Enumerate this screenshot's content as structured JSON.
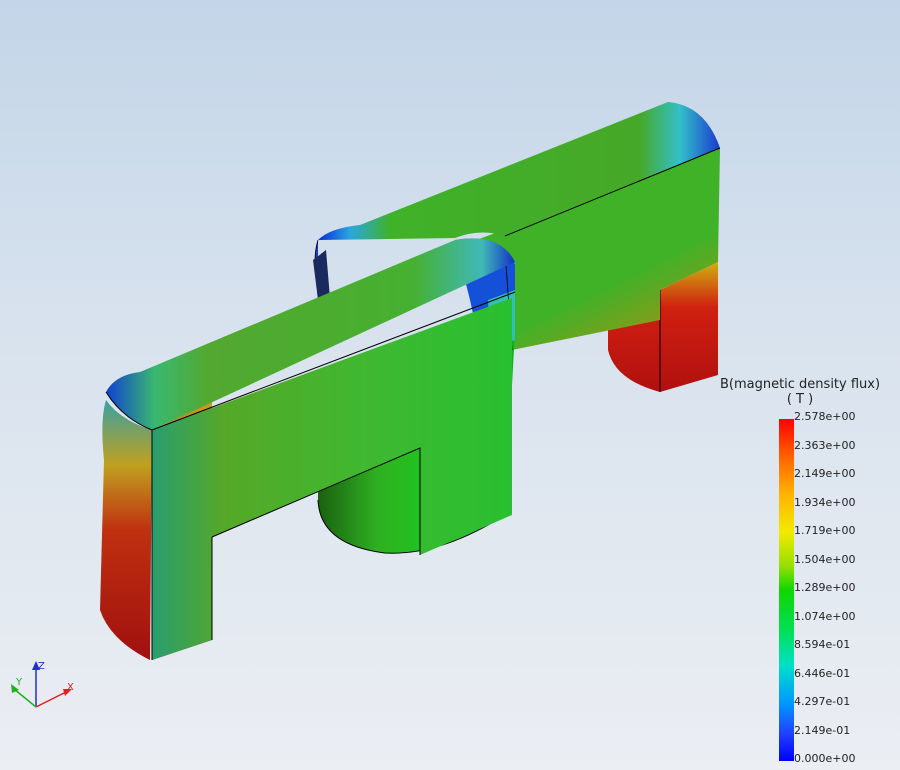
{
  "legend": {
    "title": "B(magnetic density flux)",
    "unit": "( T )",
    "ticks": [
      "2.578e+00",
      "2.363e+00",
      "2.149e+00",
      "1.934e+00",
      "1.719e+00",
      "1.504e+00",
      "1.289e+00",
      "1.074e+00",
      "8.594e-01",
      "6.446e-01",
      "4.297e-01",
      "2.149e-01",
      "0.000e+00"
    ],
    "colormap": [
      "#0000ff",
      "#0099ff",
      "#00e0c8",
      "#10d600",
      "#f2ea00",
      "#ff6a00",
      "#ff0000"
    ]
  },
  "axes_triad": {
    "x": "X",
    "y": "Y",
    "z": "Z"
  },
  "colors": {
    "x_axis": "#e02020",
    "y_axis": "#20b020",
    "z_axis": "#2030d0"
  }
}
